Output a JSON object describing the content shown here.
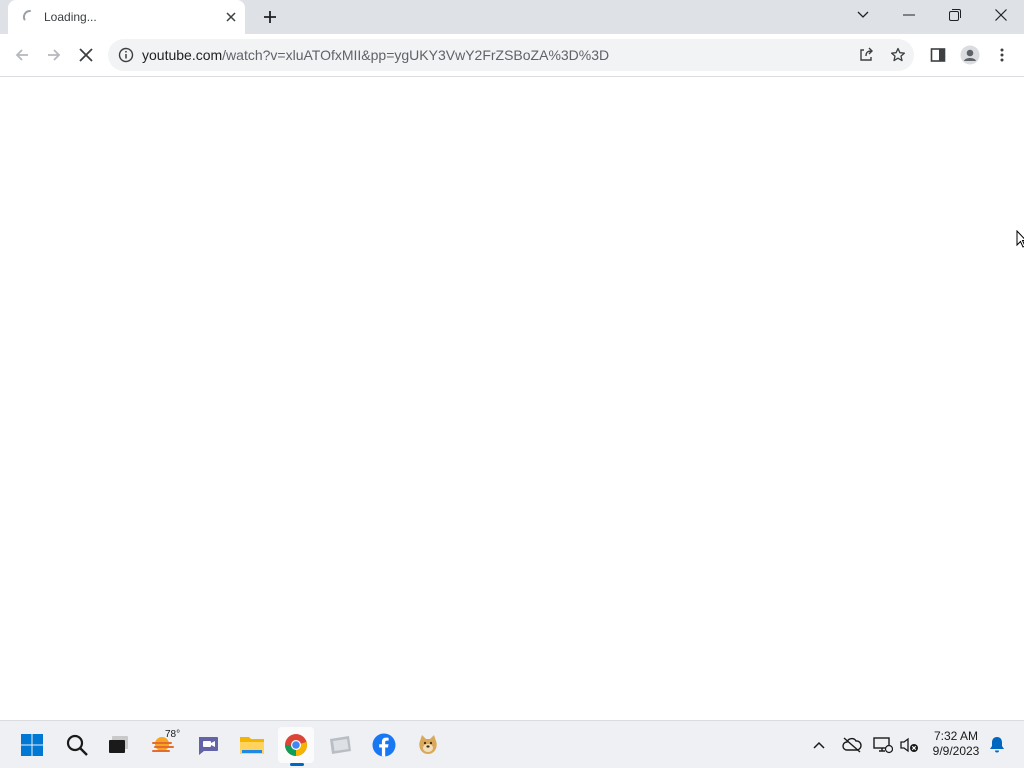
{
  "browser": {
    "tab": {
      "title": "Loading...",
      "state": "loading"
    },
    "address_bar": {
      "host": "youtube.com",
      "path": "/watch?v=xluATOfxMII&pp=ygUKY3VwY2FrZSBoZA%3D%3D"
    },
    "icons": {
      "back": "back-arrow-icon",
      "forward": "forward-arrow-icon",
      "stop": "stop-loading-icon",
      "site_info": "info-icon",
      "share": "share-icon",
      "bookmark": "star-icon",
      "side_panel": "side-panel-icon",
      "profile": "profile-icon",
      "menu": "kebab-menu-icon"
    }
  },
  "taskbar": {
    "weather": {
      "temp": "78°"
    },
    "clock": {
      "time": "7:32 AM",
      "date": "9/9/2023"
    },
    "apps": [
      "start",
      "search",
      "task-view",
      "weather",
      "teams-chat",
      "file-explorer",
      "chrome",
      "app",
      "facebook",
      "doge"
    ]
  },
  "colors": {
    "tabstrip_bg": "#dee1e6",
    "omnibox_bg": "#f1f3f4",
    "taskbar_bg": "#eef0f3",
    "accent": "#0067c0"
  }
}
